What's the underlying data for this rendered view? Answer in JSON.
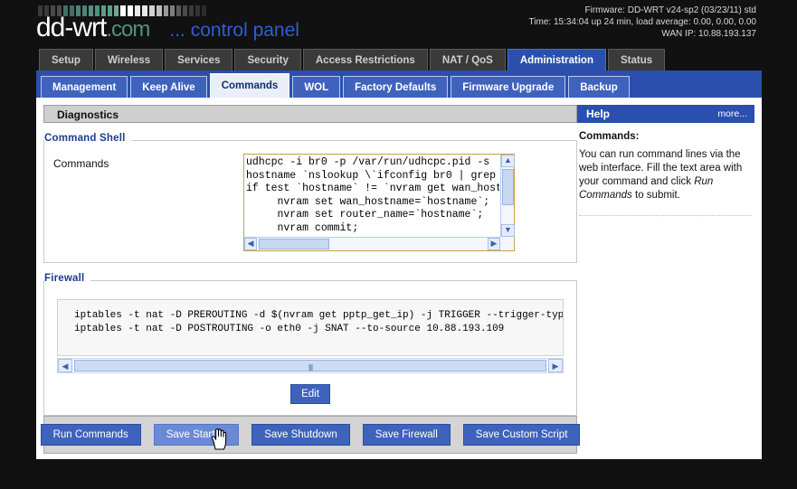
{
  "header": {
    "logo_main": "dd-wrt",
    "logo_com": ".com",
    "logo_tagline": "... control panel",
    "firmware": "Firmware: DD-WRT v24-sp2 (03/23/11) std",
    "time": "Time: 15:34:04 up 24 min, load average: 0.00, 0.00, 0.00",
    "wan_ip": "WAN IP: 10.88.193.137"
  },
  "main_tabs": [
    {
      "label": "Setup",
      "active": false
    },
    {
      "label": "Wireless",
      "active": false
    },
    {
      "label": "Services",
      "active": false
    },
    {
      "label": "Security",
      "active": false
    },
    {
      "label": "Access Restrictions",
      "active": false
    },
    {
      "label": "NAT / QoS",
      "active": false
    },
    {
      "label": "Administration",
      "active": true
    },
    {
      "label": "Status",
      "active": false
    }
  ],
  "sub_tabs": [
    {
      "label": "Management",
      "active": false
    },
    {
      "label": "Keep Alive",
      "active": false
    },
    {
      "label": "Commands",
      "active": true
    },
    {
      "label": "WOL",
      "active": false
    },
    {
      "label": "Factory Defaults",
      "active": false
    },
    {
      "label": "Firmware Upgrade",
      "active": false
    },
    {
      "label": "Backup",
      "active": false
    }
  ],
  "section": {
    "title": "Diagnostics"
  },
  "command_shell": {
    "legend": "Command Shell",
    "field_label": "Commands",
    "textarea_value": "udhcpc -i br0 -p /var/run/udhcpc.pid -s \nhostname `nslookup \\`ifconfig br0 | grep\nif test `hostname` != `nvram get wan_host\n     nvram set wan_hostname=`hostname`;\n     nvram set router_name=`hostname`;\n     nvram commit;"
  },
  "firewall": {
    "legend": "Firewall",
    "rules": "iptables -t nat -D PREROUTING -d $(nvram get pptp_get_ip) -j TRIGGER --trigger-type dnat\niptables -t nat -D POSTROUTING -o eth0 -j SNAT --to-source 10.88.193.109",
    "edit_label": "Edit"
  },
  "buttons": [
    {
      "label": "Run Commands",
      "hover": false
    },
    {
      "label": "Save Startup",
      "hover": true
    },
    {
      "label": "Save Shutdown",
      "hover": false
    },
    {
      "label": "Save Firewall",
      "hover": false
    },
    {
      "label": "Save Custom Script",
      "hover": false
    }
  ],
  "help": {
    "title": "Help",
    "more_label": "more...",
    "heading": "Commands:",
    "text_before": "You can run command lines via the web interface. Fill the text area with your command and click ",
    "text_em": "Run Commands",
    "text_after": " to submit."
  },
  "colors": {
    "brand_blue": "#2a4fad",
    "button_blue": "#3f63bd",
    "accent_teal": "#53907f",
    "textarea_border": "#c7a248"
  }
}
